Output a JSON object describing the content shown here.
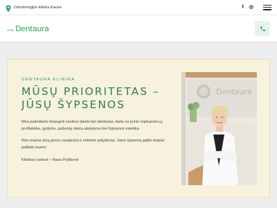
{
  "topbar": {
    "location_icon": "map-pin-icon",
    "location_text": "Odontologijos klinika Kaune",
    "social": [
      "f",
      "◎"
    ],
    "menu_icon": "hamburger-menu-icon"
  },
  "navbar": {
    "logo_prefix": "UAB",
    "logo_name": "Dentaura",
    "phone_icon": "phone-icon"
  },
  "hero": {
    "eyebrow": "DENTAURA KLINIKA",
    "headline_line1": "MŪSŲ PRIORITETAS –",
    "headline_line2": "JŪSŲ ŠYPSENOS",
    "paragraph1": "Mes padedame išsaugoti sveikus dantis bei dantenas, kartu su jumis rūpinamės jų profilaktika, gydymu, pažeistų dantų atstatymu bei šypsenos estetika.",
    "paragraph2": "Mes esame jūsų geros savijautos ir sėkmės palydovas. Savo šypseną galite drąsiai patikėti mums!",
    "signature": "Klinikos vadovė – Rasa Poškienė",
    "photo_wall_text": "Dentaura"
  },
  "colors": {
    "brand_green": "#2aa05c",
    "headline_green": "#2e7f54",
    "hero_bg": "#f6f2dd"
  }
}
